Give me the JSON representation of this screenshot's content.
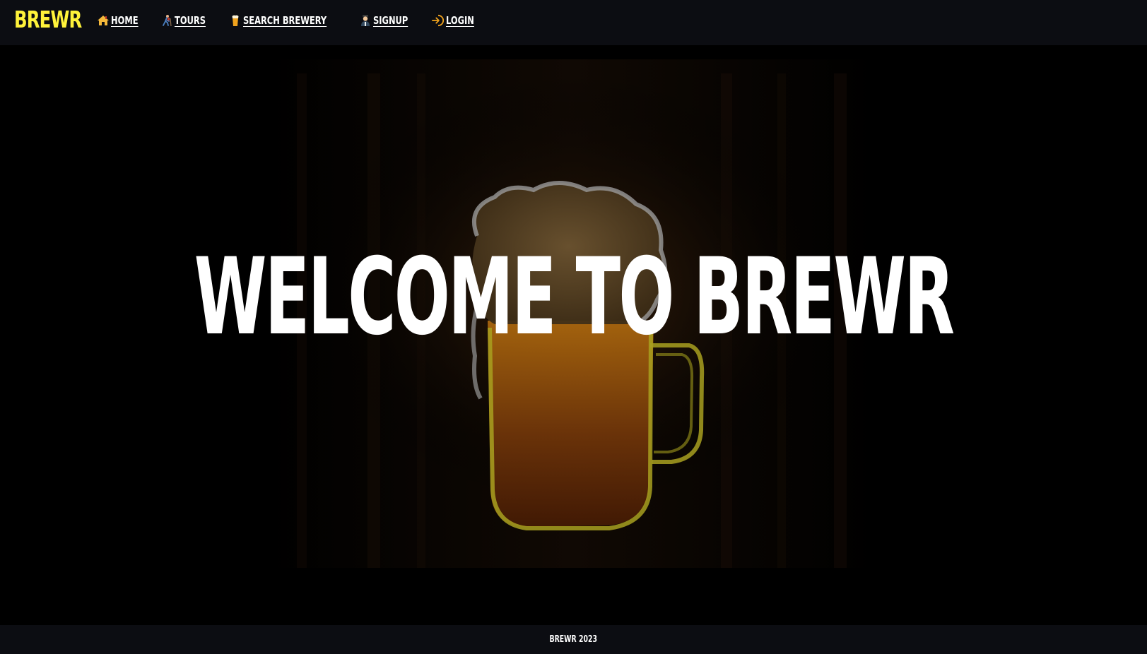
{
  "navbar": {
    "brand": "BREWR",
    "links": [
      {
        "label": "HOME",
        "icon": "house-icon"
      },
      {
        "label": "TOURS",
        "icon": "hiker-icon"
      },
      {
        "label": "SEARCH BREWERY",
        "icon": "beer-mug-icon"
      },
      {
        "label": "SIGNUP",
        "icon": "person-icon"
      },
      {
        "label": "LOGIN",
        "icon": "login-arrow-icon"
      }
    ]
  },
  "hero": {
    "title": "WELCOME TO BREWR",
    "background": "neon-beer-mug-image"
  },
  "footer": {
    "text": "BREWR 2023"
  },
  "colors": {
    "brand": "#fff23a",
    "navbar_bg": "#0c0d12",
    "hero_bg": "#000000",
    "text": "#ffffff"
  }
}
